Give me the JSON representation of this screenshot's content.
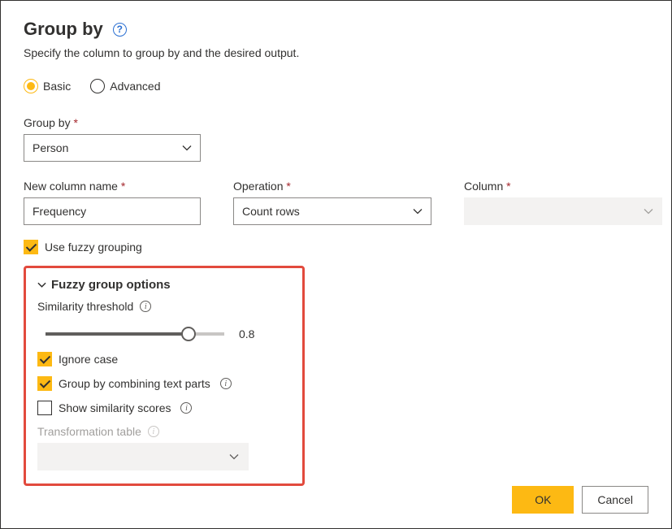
{
  "title": "Group by",
  "subtitle": "Specify the column to group by and the desired output.",
  "mode": {
    "basic": "Basic",
    "advanced": "Advanced",
    "selected": "basic"
  },
  "groupBy": {
    "label": "Group by",
    "value": "Person"
  },
  "newColumn": {
    "label": "New column name",
    "value": "Frequency"
  },
  "operation": {
    "label": "Operation",
    "value": "Count rows"
  },
  "column": {
    "label": "Column",
    "value": ""
  },
  "useFuzzy": {
    "label": "Use fuzzy grouping",
    "checked": true
  },
  "fuzzy": {
    "header": "Fuzzy group options",
    "similarity": {
      "label": "Similarity threshold",
      "value": 0.8,
      "display": "0.8",
      "percent": 80
    },
    "ignoreCase": {
      "label": "Ignore case",
      "checked": true
    },
    "combineText": {
      "label": "Group by combining text parts",
      "checked": true
    },
    "showScores": {
      "label": "Show similarity scores",
      "checked": false
    },
    "transformTable": {
      "label": "Transformation table",
      "value": ""
    }
  },
  "buttons": {
    "ok": "OK",
    "cancel": "Cancel"
  }
}
